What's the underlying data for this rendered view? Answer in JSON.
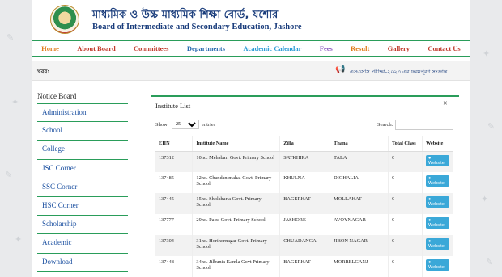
{
  "header": {
    "title_bn": "মাধ্যমিক ও উচ্চ মাধ্যমিক শিক্ষা বোর্ড, যশোর",
    "title_en": "Board of Intermediate and Secondary Education, Jashore"
  },
  "nav": [
    {
      "label": "Home",
      "color": "#e07b1a"
    },
    {
      "label": "About Board",
      "color": "#c0392b"
    },
    {
      "label": "Committees",
      "color": "#c0392b"
    },
    {
      "label": "Departments",
      "color": "#2b6cb0"
    },
    {
      "label": "Academic Calendar",
      "color": "#2b9bd6"
    },
    {
      "label": "Fees",
      "color": "#8e5fc2"
    },
    {
      "label": "Result",
      "color": "#e07b1a"
    },
    {
      "label": "Gallery",
      "color": "#c0392b"
    },
    {
      "label": "Contact Us",
      "color": "#c0392b"
    }
  ],
  "ticker": {
    "label": "খবর:",
    "text": "এসএসসি পরীক্ষা-২০২৩ এর ফরমপূরণ সংক্রান্ত"
  },
  "sidebar": {
    "title": "Notice Board",
    "items": [
      "Administration",
      "School",
      "College",
      "JSC Corner",
      "SSC Corner",
      "HSC Corner",
      "Scholarship",
      "Academic",
      "Download"
    ]
  },
  "panel": {
    "title": "Institute List",
    "minimize": "−",
    "close": "×",
    "show_label": "Show",
    "page_size": "25",
    "entries_label": "entries",
    "search_label": "Search:",
    "search_value": ""
  },
  "table": {
    "columns": [
      "EIIN",
      "Institute Name",
      "Zilla",
      "Thana",
      "Total Class",
      "Website"
    ],
    "button_label": "Website",
    "rows": [
      {
        "eiin": "137312",
        "name": "10no. Mehabari Govt. Primary School",
        "zilla": "SATKHIRA",
        "thana": "TALA",
        "classes": "0"
      },
      {
        "eiin": "137485",
        "name": "12no. Chandanimahal Govt. Primary School",
        "zilla": "KHULNA",
        "thana": "DIGHALIA",
        "classes": "0"
      },
      {
        "eiin": "137445",
        "name": "15no. Sholabaria Govt. Primary School",
        "zilla": "BAGERHAT",
        "thana": "MOLLAHAT",
        "classes": "0"
      },
      {
        "eiin": "137777",
        "name": "29no. Paira Govt. Primary School",
        "zilla": "JASHORE",
        "thana": "AVOYNAGAR",
        "classes": "0"
      },
      {
        "eiin": "137304",
        "name": "31no. Horihornagar Govt. Primary School",
        "zilla": "CHUADANGA",
        "thana": "JIBON NAGAR",
        "classes": "0"
      },
      {
        "eiin": "137448",
        "name": "34no. Jilbunia Kamla Govt Primary School",
        "zilla": "BAGERHAT",
        "thana": "MORRELGANJ",
        "classes": "0"
      }
    ]
  }
}
